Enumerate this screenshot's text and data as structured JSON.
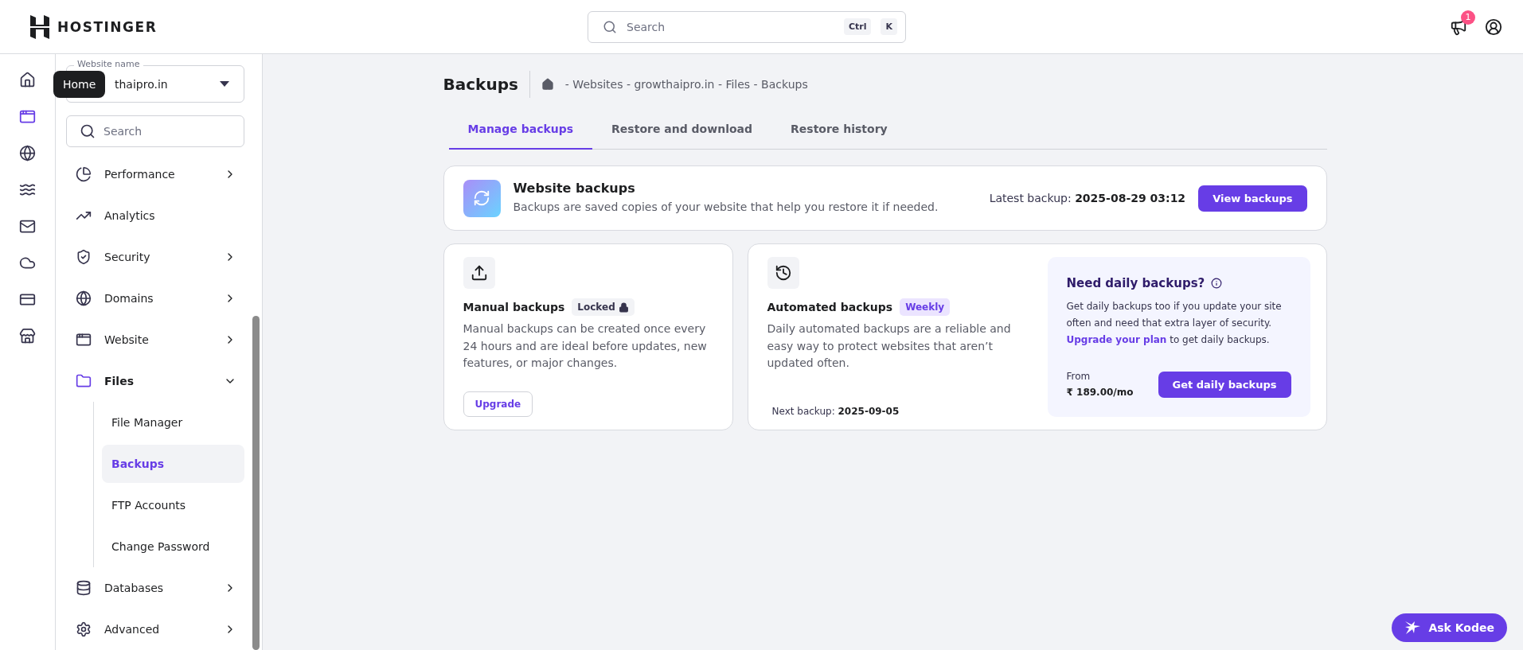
{
  "header": {
    "logo": "HOSTINGER",
    "search": {
      "placeholder": "Search",
      "keys": [
        "Ctrl",
        "K"
      ]
    },
    "notifications": {
      "count": "1"
    }
  },
  "rail": {
    "items": [
      {
        "selected": false
      },
      {
        "selected": true
      },
      {
        "selected": false
      },
      {
        "selected": false
      },
      {
        "selected": false
      },
      {
        "selected": false
      },
      {
        "selected": false
      },
      {
        "selected": false
      }
    ],
    "tooltip": "Home"
  },
  "sidebar": {
    "site_select": {
      "label": "Website name",
      "value": "thaipro.in"
    },
    "search": {
      "placeholder": "Search"
    },
    "items": [
      {
        "label": "Performance",
        "expanded": false
      },
      {
        "label": "Analytics"
      },
      {
        "label": "Security",
        "expanded": false
      },
      {
        "label": "Domains",
        "expanded": false
      },
      {
        "label": "Website",
        "expanded": false
      },
      {
        "label": "Files",
        "expanded": true,
        "children": [
          {
            "label": "File Manager",
            "selected": false
          },
          {
            "label": "Backups",
            "selected": true
          },
          {
            "label": "FTP Accounts",
            "selected": false
          },
          {
            "label": "Change Password",
            "selected": false
          }
        ]
      },
      {
        "label": "Databases",
        "expanded": false
      },
      {
        "label": "Advanced",
        "expanded": false
      }
    ]
  },
  "page": {
    "title": "Backups",
    "breadcrumb": "- Websites - growthaipro.in - Files - Backups",
    "tabs": [
      {
        "label": "Manage backups",
        "selected": true
      },
      {
        "label": "Restore and download",
        "selected": false
      },
      {
        "label": "Restore history",
        "selected": false
      }
    ],
    "summary": {
      "title": "Website backups",
      "description": "Backups are saved copies of your website that help you restore it if needed.",
      "latest_label": "Latest backup:",
      "latest_value": "2025-08-29 03:12",
      "button": "View backups"
    },
    "manual": {
      "title": "Manual backups",
      "badge": "Locked",
      "description": "Manual backups can be created once every 24 hours and are ideal before updates, new features, or major changes.",
      "button": "Upgrade"
    },
    "automated": {
      "title": "Automated backups",
      "badge": "Weekly",
      "description": "Daily automated backups are a reliable and easy way to protect websites that aren’t updated often.",
      "next_label": "Next backup:",
      "next_value": "2025-09-05"
    },
    "promo": {
      "title": "Need daily backups?",
      "text": "Get daily backups too if you update your site often and need that extra layer of security.",
      "link": "Upgrade your plan",
      "link_tail": "to get daily backups.",
      "price_label": "From",
      "price": "₹ 189.00/mo",
      "button": "Get daily backups"
    }
  },
  "assistant": {
    "label": "Ask Kodee"
  }
}
